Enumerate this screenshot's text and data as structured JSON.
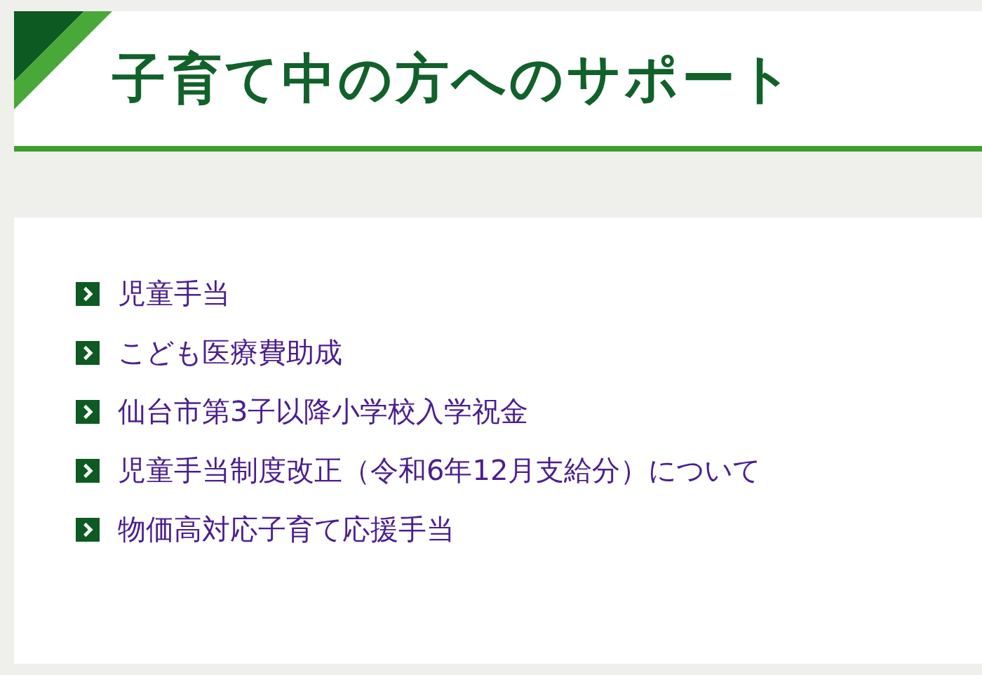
{
  "header": {
    "title": "子育て中の方へのサポート"
  },
  "links": [
    {
      "label": "児童手当"
    },
    {
      "label": "こども医療費助成"
    },
    {
      "label": "仙台市第3子以降小学校入学祝金"
    },
    {
      "label": "児童手当制度改正（令和6年12月支給分）について"
    },
    {
      "label": "物価高対応子育て応援手当"
    }
  ]
}
